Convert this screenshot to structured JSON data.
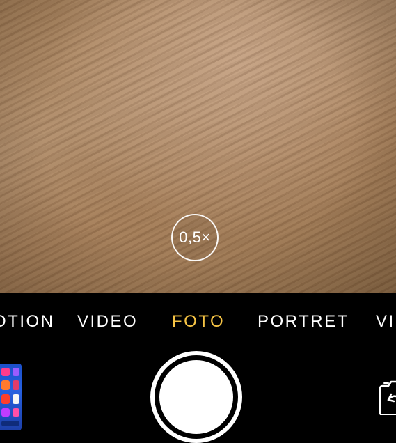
{
  "zoom": {
    "label": "0,5×"
  },
  "modes": [
    {
      "label": "OTION",
      "active": false
    },
    {
      "label": "VIDEO",
      "active": false
    },
    {
      "label": "FOTO",
      "active": true
    },
    {
      "label": "PORTRET",
      "active": false
    },
    {
      "label": "VIE",
      "active": false
    }
  ],
  "colors": {
    "active_mode": "#f6c445",
    "background": "#000000",
    "text": "#ffffff"
  },
  "icons": {
    "shutter": "shutter-button",
    "thumbnail": "last-photo-thumbnail",
    "flip": "camera-flip-icon"
  }
}
